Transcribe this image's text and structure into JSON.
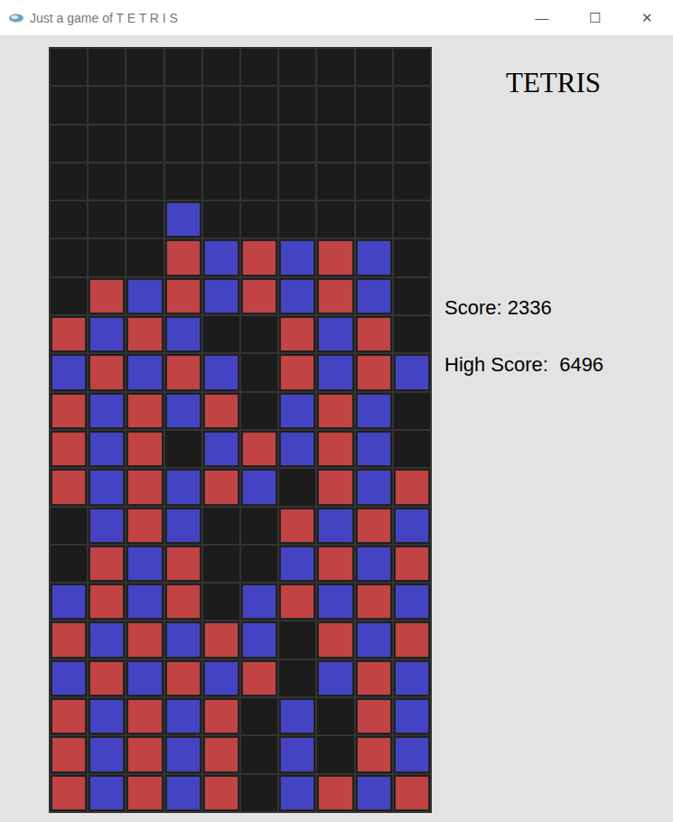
{
  "window": {
    "title": "Just a game of T E T R I S",
    "controls": [
      "—",
      "☐",
      "✕"
    ]
  },
  "heading": "TETRIS",
  "score": {
    "label": "Score:",
    "value": "2336"
  },
  "high_score": {
    "label": "High Score:",
    "value": "6496"
  },
  "colors": {
    "R": "#c24343",
    "B": "#4343c4"
  },
  "board": [
    "..........",
    "..........",
    "..........",
    "..........",
    "...B......",
    "...RBRBRB.",
    ".RBRBRBRB.",
    "RBRB..RBR.",
    "BRBRB.RBRB",
    "RBRBR.BRB.",
    "RBR.BRBRB.",
    "RBRBRB.RBR",
    ".BRB..RBRB",
    ".RBR..BRBR",
    "BRBR.BRBRB",
    "RBRBRB.RBR",
    "BRBRBR.BRB",
    "RBRBR.B.RB",
    "RBRBR.B.RB",
    "RBRBR.BRBR"
  ]
}
